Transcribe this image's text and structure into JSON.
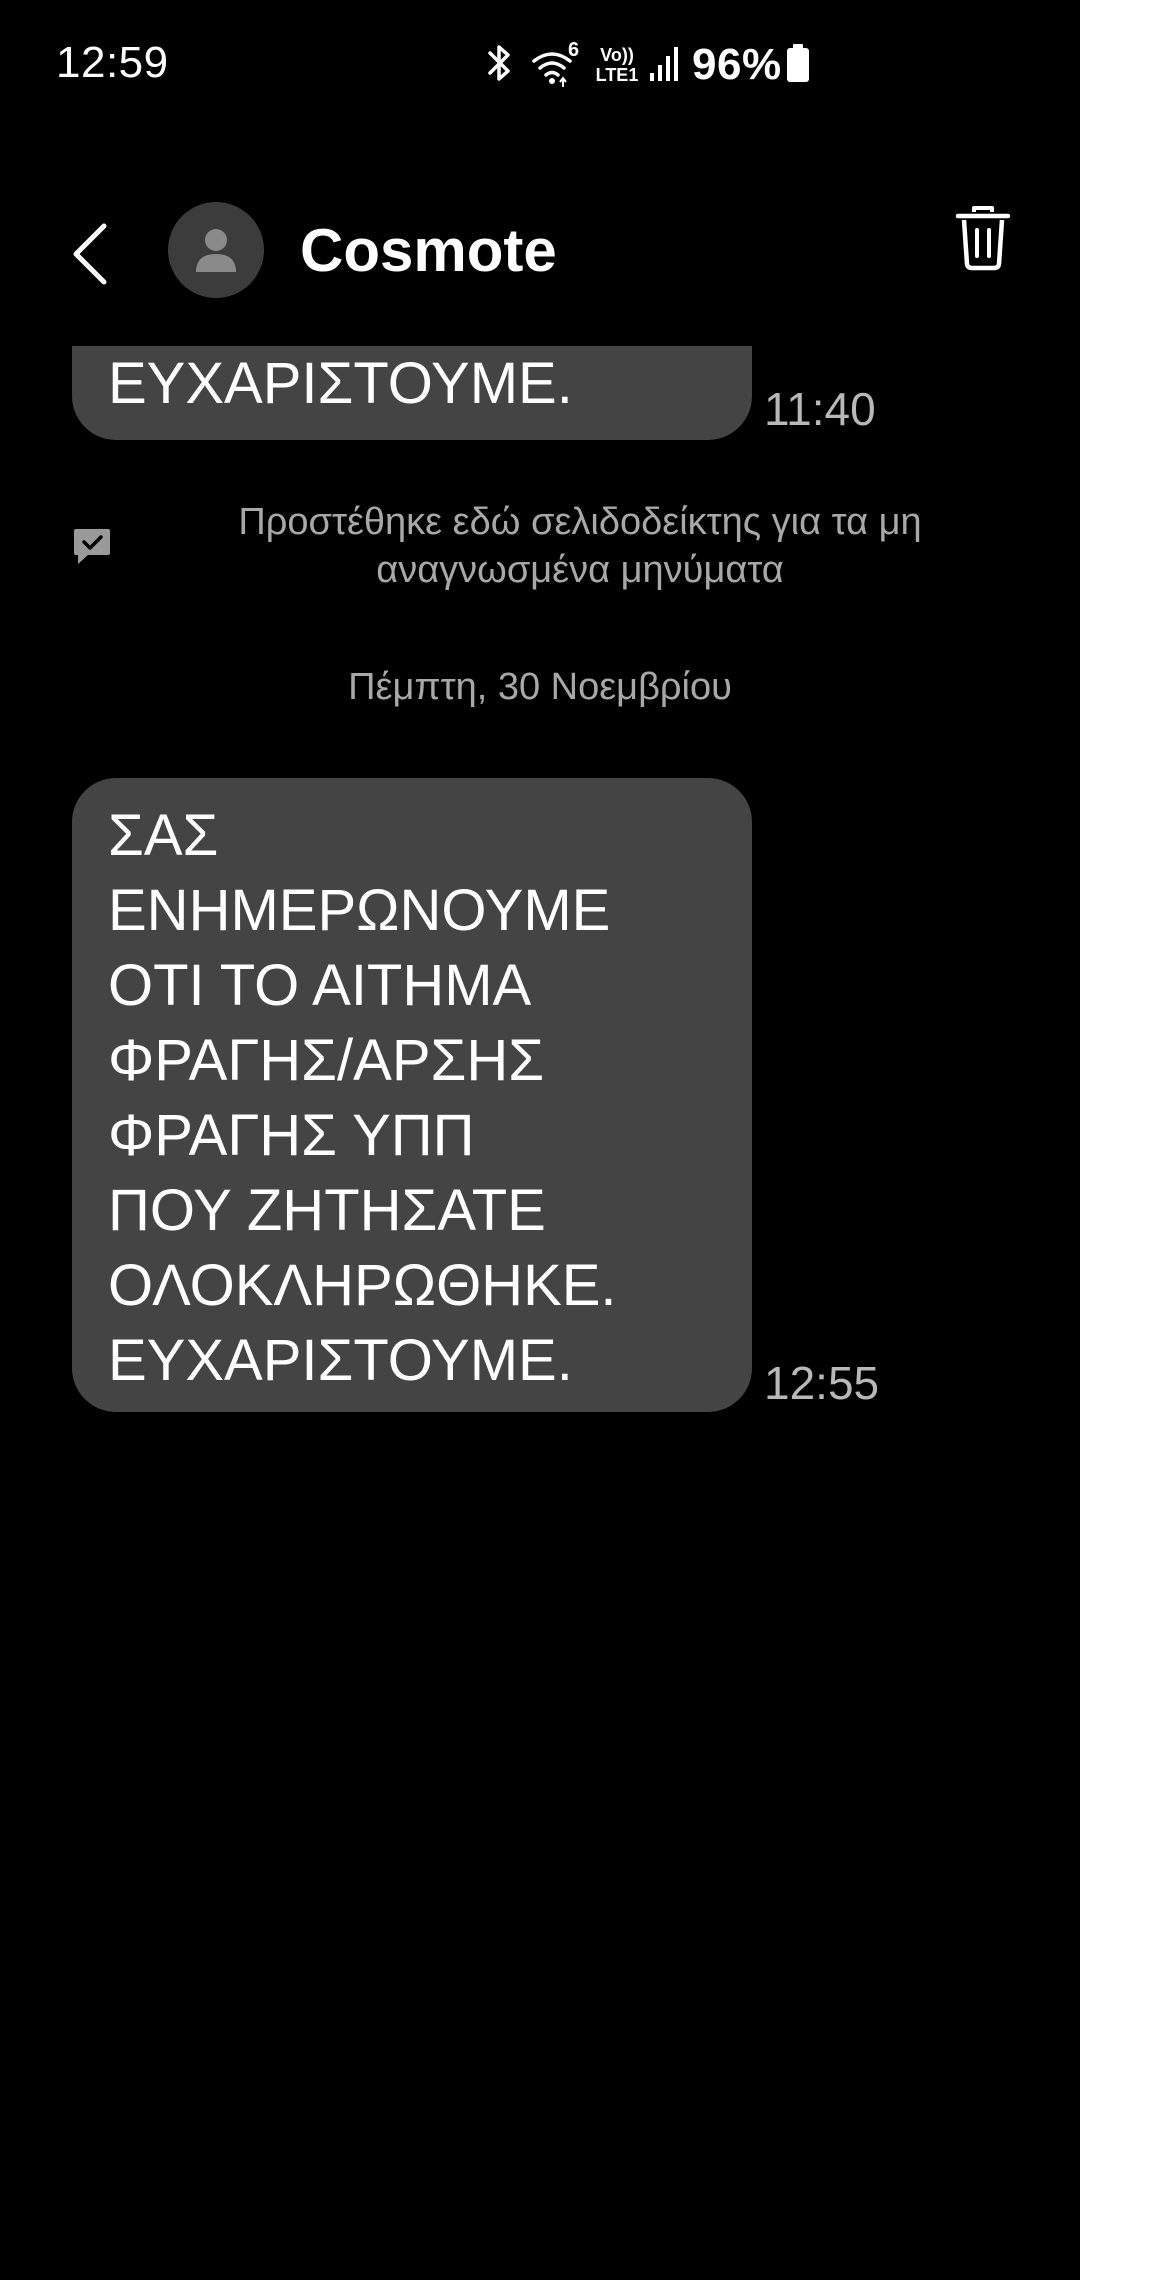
{
  "status_bar": {
    "time": "12:59",
    "battery_percent": "96%",
    "icons": [
      "bluetooth-icon",
      "wifi-6-icon",
      "volte-lte1-icon",
      "cellular-signal-icon",
      "battery-icon"
    ],
    "wifi_badge": "6",
    "volte_top": "Vo))",
    "volte_bottom": "LTE1"
  },
  "app_bar": {
    "contact_name": "Cosmote",
    "back_icon": "chevron-left-icon",
    "avatar_icon": "person-icon",
    "delete_icon": "trash-icon"
  },
  "conversation": {
    "messages": [
      {
        "text": "ΕΥΧΑΡΙΣΤΟΥΜΕ.",
        "time": "11:40"
      },
      {
        "text": "ΣΑΣ\nΕΝΗΜΕΡΩΝΟΥΜΕ\nΟΤΙ ΤΟ ΑΙΤΗΜΑ\nΦΡΑΓΗΣ/ΑΡΣΗΣ\nΦΡΑΓΗΣ ΥΠΠ\nΠΟΥ ΖΗΤΗΣΑΤΕ\nΟΛΟΚΛΗΡΩΘΗΚΕ.\nΕΥΧΑΡΙΣΤΟΥΜΕ.",
        "time": "12:55"
      }
    ],
    "bookmark_notice": "Προστέθηκε εδώ σελιδοδείκτης για τα μη αναγνωσμένα μηνύματα",
    "bookmark_icon": "bookmark-chat-icon",
    "date_divider": "Πέμπτη, 30 Νοεμβρίου"
  },
  "colors": {
    "background": "#000000",
    "bubble": "#444444",
    "text": "#ffffff",
    "secondary_text": "#a8a8a8"
  }
}
